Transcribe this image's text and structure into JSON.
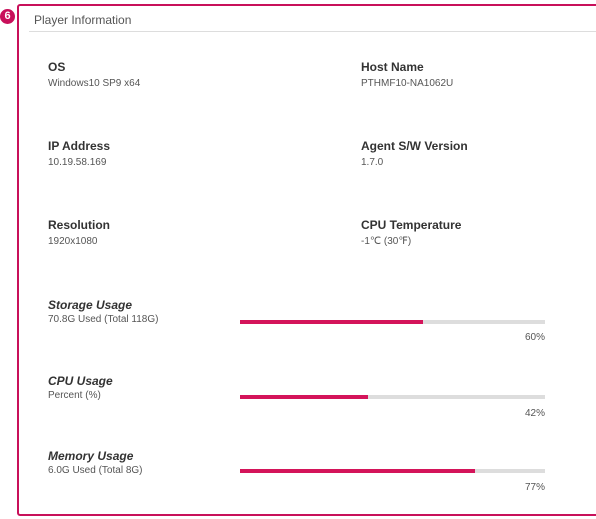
{
  "step_badge": "6",
  "panel": {
    "title": "Player Information"
  },
  "fields": {
    "os": {
      "label": "OS",
      "value": "Windows10 SP9 x64"
    },
    "host_name": {
      "label": "Host Name",
      "value": "PTHMF10-NA1062U"
    },
    "ip_address": {
      "label": "IP Address",
      "value": "10.19.58.169"
    },
    "agent_version": {
      "label": "Agent S/W Version",
      "value": "1.7.0"
    },
    "resolution": {
      "label": "Resolution",
      "value": "1920x1080"
    },
    "cpu_temperature": {
      "label": "CPU Temperature",
      "value": "-1℃ (30℉)"
    }
  },
  "usage": {
    "storage": {
      "label": "Storage Usage",
      "detail": "70.8G Used (Total 118G)",
      "percent": 60,
      "percent_label": "60%"
    },
    "cpu": {
      "label": "CPU Usage",
      "detail": "Percent (%)",
      "percent": 42,
      "percent_label": "42%"
    },
    "memory": {
      "label": "Memory Usage",
      "detail": "6.0G Used (Total 8G)",
      "percent": 77,
      "percent_label": "77%"
    }
  },
  "colors": {
    "accent": "#c8105a",
    "bar_fill": "#d4145a",
    "bar_track": "#dddddd"
  }
}
